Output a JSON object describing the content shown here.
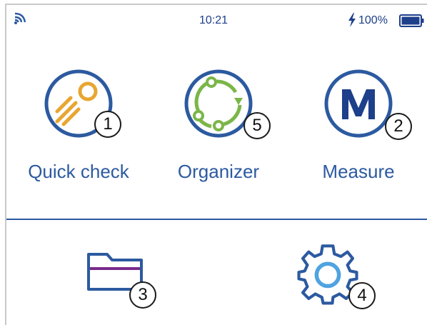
{
  "status_bar": {
    "time": "10:21",
    "battery_percent": "100%",
    "battery_level": 1.0,
    "charging": true,
    "icons": [
      "wifi-icon",
      "charging-bolt-icon",
      "battery-icon"
    ]
  },
  "apps": [
    {
      "label": "Quick check",
      "badge": "1",
      "icon": "quick-check-icon"
    },
    {
      "label": "Organizer",
      "badge": "5",
      "icon": "organizer-cycle-icon"
    },
    {
      "label": "Measure",
      "badge": "2",
      "icon": "measure-m-icon"
    }
  ],
  "bottom": [
    {
      "badge": "3",
      "icon": "folder-icon"
    },
    {
      "badge": "4",
      "icon": "gear-icon"
    }
  ],
  "colors": {
    "primary": "#2c5aa0",
    "dark_blue": "#1e3f8a",
    "orange": "#e8a631",
    "green": "#7ab648",
    "purple": "#7a2a8a",
    "light_blue": "#4fa3e0"
  }
}
